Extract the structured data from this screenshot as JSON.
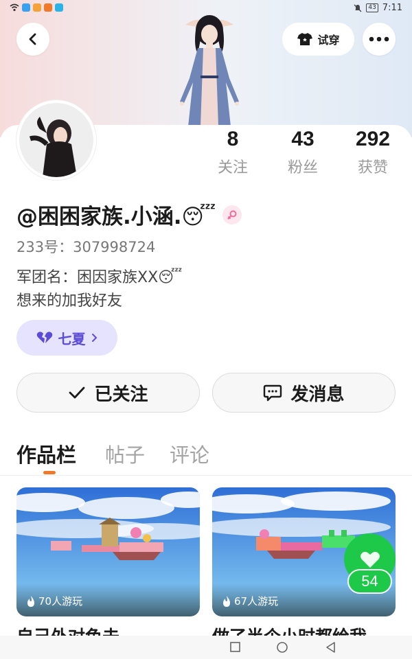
{
  "status_bar": {
    "time": "7:11",
    "battery": "43"
  },
  "header": {
    "tryon_label": "试穿"
  },
  "profile": {
    "username": "@困困家族.小涵.😴",
    "uid_label": "233号：",
    "uid": "307998724",
    "bio_line1": "军团名：困因家族XX😴",
    "bio_line2": "想来的加我好友",
    "team_chip": "七夏"
  },
  "stats": [
    {
      "value": "8",
      "label": "关注"
    },
    {
      "value": "43",
      "label": "粉丝"
    },
    {
      "value": "292",
      "label": "获赞"
    }
  ],
  "actions": {
    "follow_label": "已关注",
    "message_label": "发消息"
  },
  "tabs": [
    {
      "label": "作品栏",
      "active": true
    },
    {
      "label": "帖子",
      "active": false
    },
    {
      "label": "评论",
      "active": false
    }
  ],
  "works": [
    {
      "plays": "70人游玩",
      "title": "自己外对色未"
    },
    {
      "plays": "67人游玩",
      "title": "做了半个小时都给我"
    }
  ],
  "like_fab": {
    "count": "54"
  },
  "colors": {
    "accent_orange": "#f07a2a",
    "chip_bg": "#e6e3ff",
    "chip_text": "#5b4bd6",
    "like_green": "#1ec94a"
  }
}
